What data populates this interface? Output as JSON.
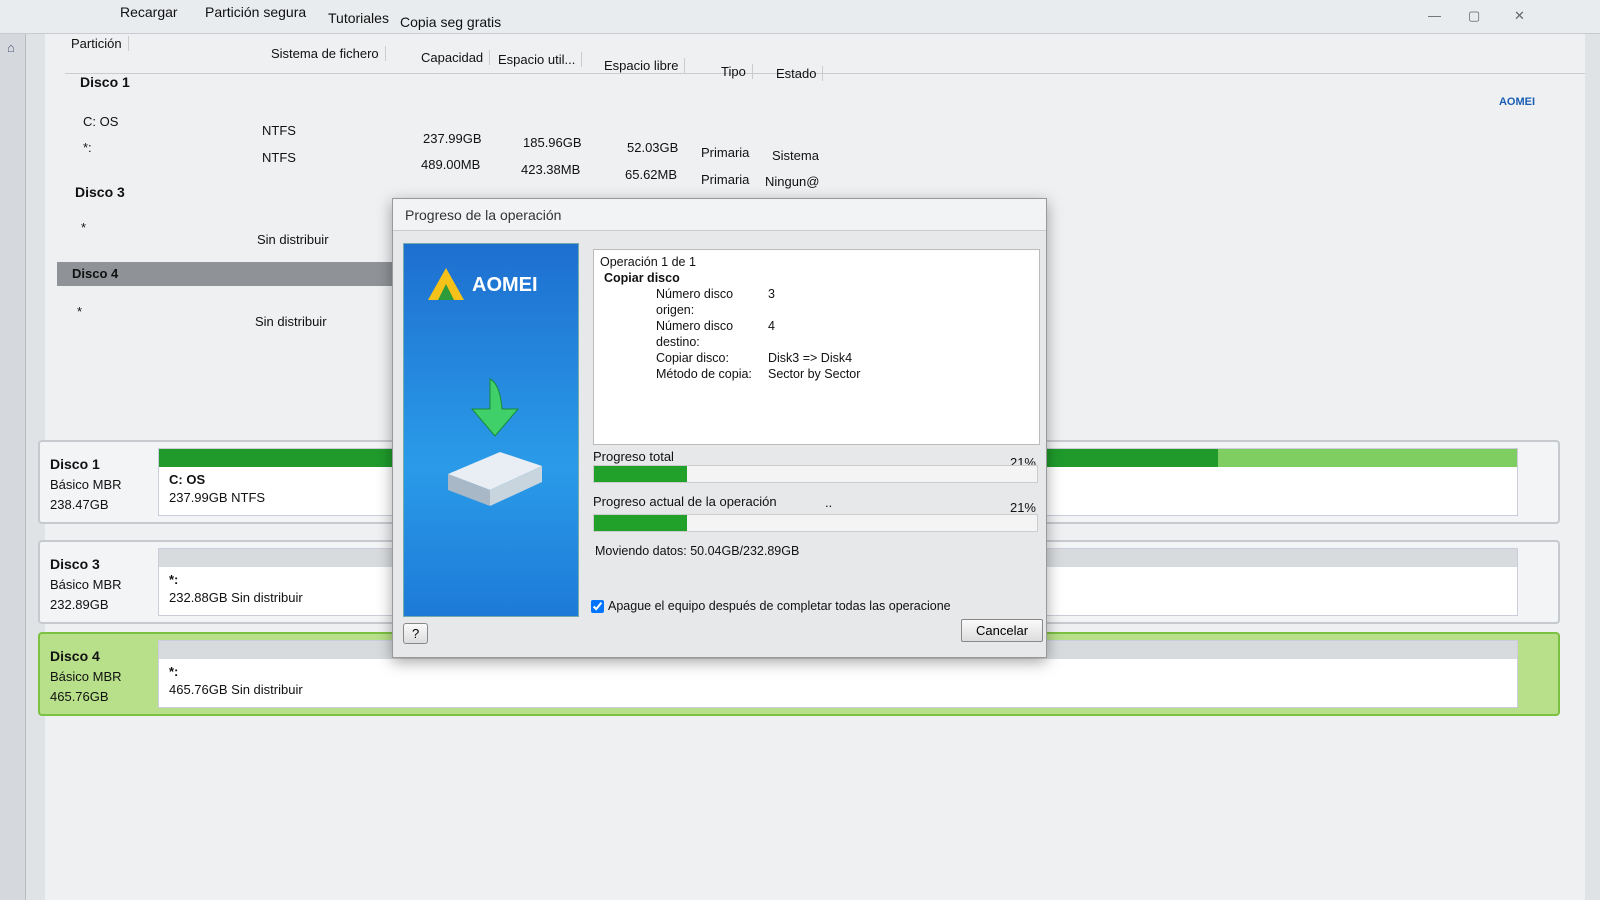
{
  "toolbar": {
    "items": [
      "Recargar",
      "Partición segura",
      "Tutoriales",
      "Copia seg gratis"
    ]
  },
  "logo": "AOMEI",
  "table": {
    "headers": [
      "Partición",
      "Sistema de fichero",
      "Capacidad",
      "Espacio util...",
      "Espacio libre",
      "Tipo",
      "Estado"
    ],
    "disks": [
      {
        "name": "Disco 1",
        "rows": [
          [
            "C: OS",
            "NTFS",
            "237.99GB",
            "185.96GB",
            "52.03GB",
            "Primaria",
            "Sistema"
          ],
          [
            "*:",
            "NTFS",
            "489.00MB",
            "423.38MB",
            "65.62MB",
            "Primaria",
            "Ningun@"
          ]
        ]
      },
      {
        "name": "Disco 3",
        "rows": [
          [
            "*",
            "Sin distribuir"
          ]
        ]
      },
      {
        "name": "Disco 4",
        "rows": [
          [
            "*",
            "Sin distribuir"
          ]
        ]
      }
    ]
  },
  "cards": [
    {
      "name": "Disco 1",
      "type": "Básico MBR",
      "size": "238.47GB",
      "part_label": "C: OS",
      "part_desc": "237.99GB NTFS",
      "used_pct": 78
    },
    {
      "name": "Disco 3",
      "type": "Básico MBR",
      "size": "232.89GB",
      "part_label": "*:",
      "part_desc": "232.88GB Sin distribuir"
    },
    {
      "name": "Disco 4",
      "type": "Básico MBR",
      "size": "465.76GB",
      "part_label": "*:",
      "part_desc": "465.76GB Sin distribuir"
    }
  ],
  "dialog": {
    "title": "Progreso de la operación",
    "brand": "AOMEI",
    "operation": "Operación 1 de 1",
    "op_name": "Copiar disco",
    "details": [
      [
        "Número disco origen:",
        "3"
      ],
      [
        "Número disco destino:",
        "4"
      ],
      [
        "Copiar disco:",
        "Disk3 => Disk4"
      ],
      [
        "Método de copia:",
        "Sector by Sector"
      ]
    ],
    "total_label": "Progreso total",
    "total_pct_text": "21%",
    "total_pct": 21,
    "current_label": "Progreso actual de la operación",
    "current_dots": "..",
    "current_pct_text": "21%",
    "current_pct": 21,
    "moving": "Moviendo datos: 50.04GB/232.89GB",
    "shutdown_label": "Apague el equipo después de completar todas las operaciones",
    "shutdown_checked": true,
    "help": "?",
    "cancel": "Cancelar"
  }
}
